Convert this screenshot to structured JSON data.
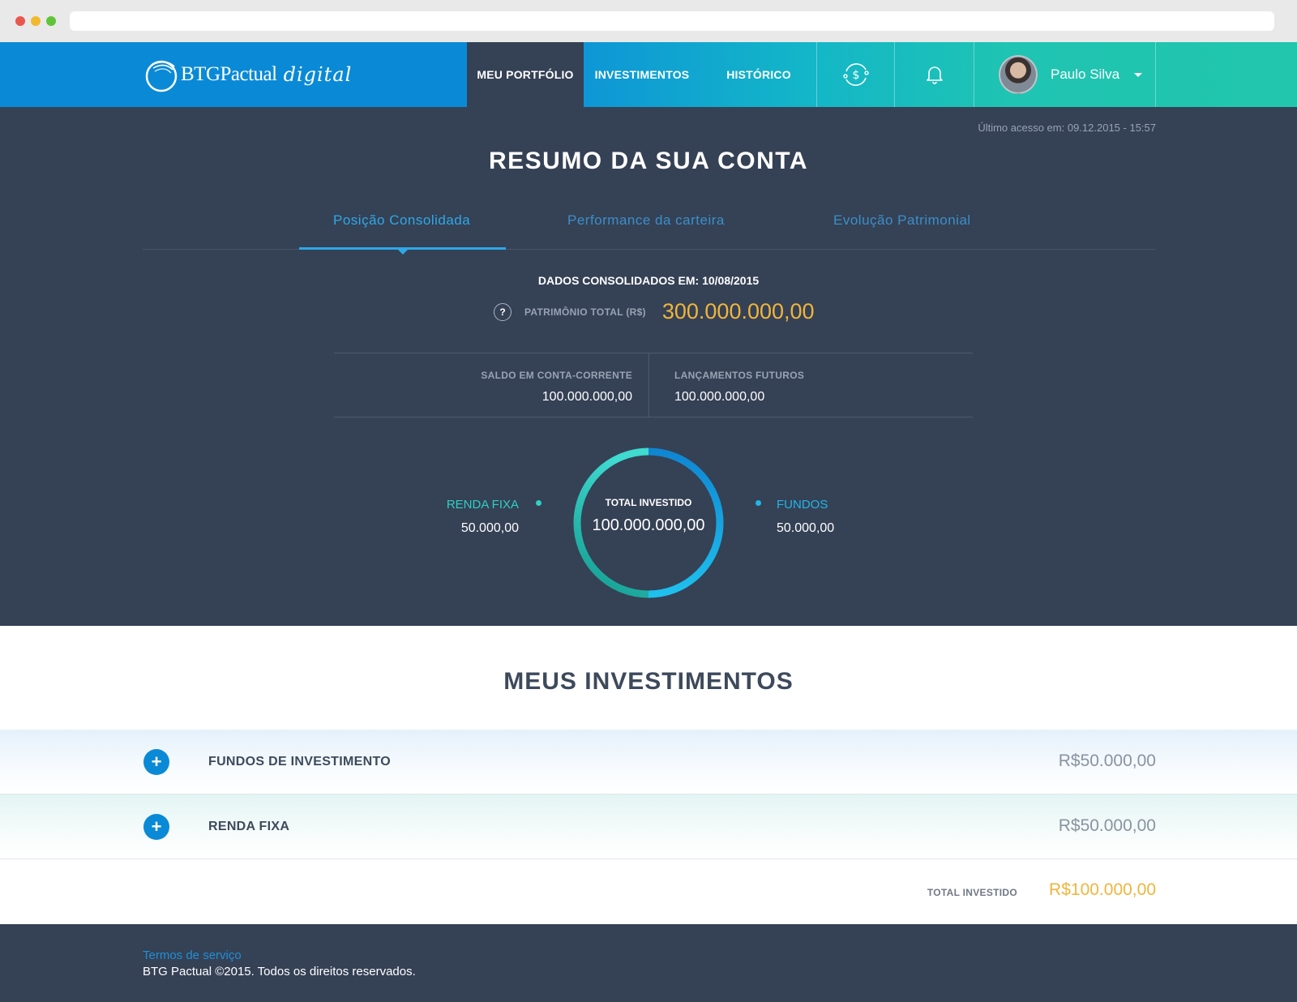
{
  "header": {
    "logo_text": "BTGPactual",
    "logo_script": "digital",
    "nav": {
      "portfolio": "MEU PORTFÓLIO",
      "investments": "INVESTIMENTOS",
      "history": "HISTÓRICO"
    },
    "icons": [
      "money-exchange-icon",
      "bell-icon"
    ],
    "user": {
      "name": "Paulo Silva"
    }
  },
  "summary": {
    "last_access": "Último acesso em: 09.12.2015 - 15:57",
    "title": "RESUMO DA SUA CONTA",
    "tabs": [
      {
        "label": "Posição Consolidada",
        "active": true
      },
      {
        "label": "Performance da carteira",
        "active": false
      },
      {
        "label": "Evolução Patrimonial",
        "active": false
      }
    ],
    "consolidated_label": "DADOS CONSOLIDADOS EM: 10/08/2015",
    "patrimonio": {
      "help": "?",
      "label": "PATRIMÔNIO TOTAL (R$)",
      "value": "300.000.000,00"
    },
    "balances": {
      "checking": {
        "label": "SALDO EM CONTA-CORRENTE",
        "value": "100.000.000,00"
      },
      "future": {
        "label": "LANÇAMENTOS FUTUROS",
        "value": "100.000.000,00"
      }
    },
    "donut": {
      "center_label": "TOTAL INVESTIDO",
      "center_value": "100.000.000,00",
      "left": {
        "name": "RENDA FIXA",
        "value": "50.000,00"
      },
      "right": {
        "name": "FUNDOS",
        "value": "50.000,00"
      }
    }
  },
  "chart_data": {
    "type": "pie",
    "categories": [
      "RENDA FIXA",
      "FUNDOS"
    ],
    "values": [
      50000,
      50000
    ]
  },
  "investments": {
    "title": "MEUS INVESTIMENTOS",
    "rows": [
      {
        "name": "FUNDOS DE INVESTIMENTO",
        "value": "R$50.000,00",
        "expand": "+"
      },
      {
        "name": "RENDA FIXA",
        "value": "R$50.000,00",
        "expand": "+"
      }
    ],
    "total_label": "TOTAL INVESTIDO",
    "total_value": "R$100.000,00"
  },
  "footer": {
    "terms": "Termos de serviço",
    "copyright": "BTG Pactual ©2015. Todos os direitos reservados."
  },
  "colors": {
    "header_blue": "#0a8ad6",
    "header_teal": "#22c6ad",
    "dark_bg": "#354155",
    "accent_gold": "#f0b53c",
    "tab_active": "#2ea8e6",
    "renda_fixa": "#2fd0c2",
    "fundos": "#22b6e8"
  }
}
